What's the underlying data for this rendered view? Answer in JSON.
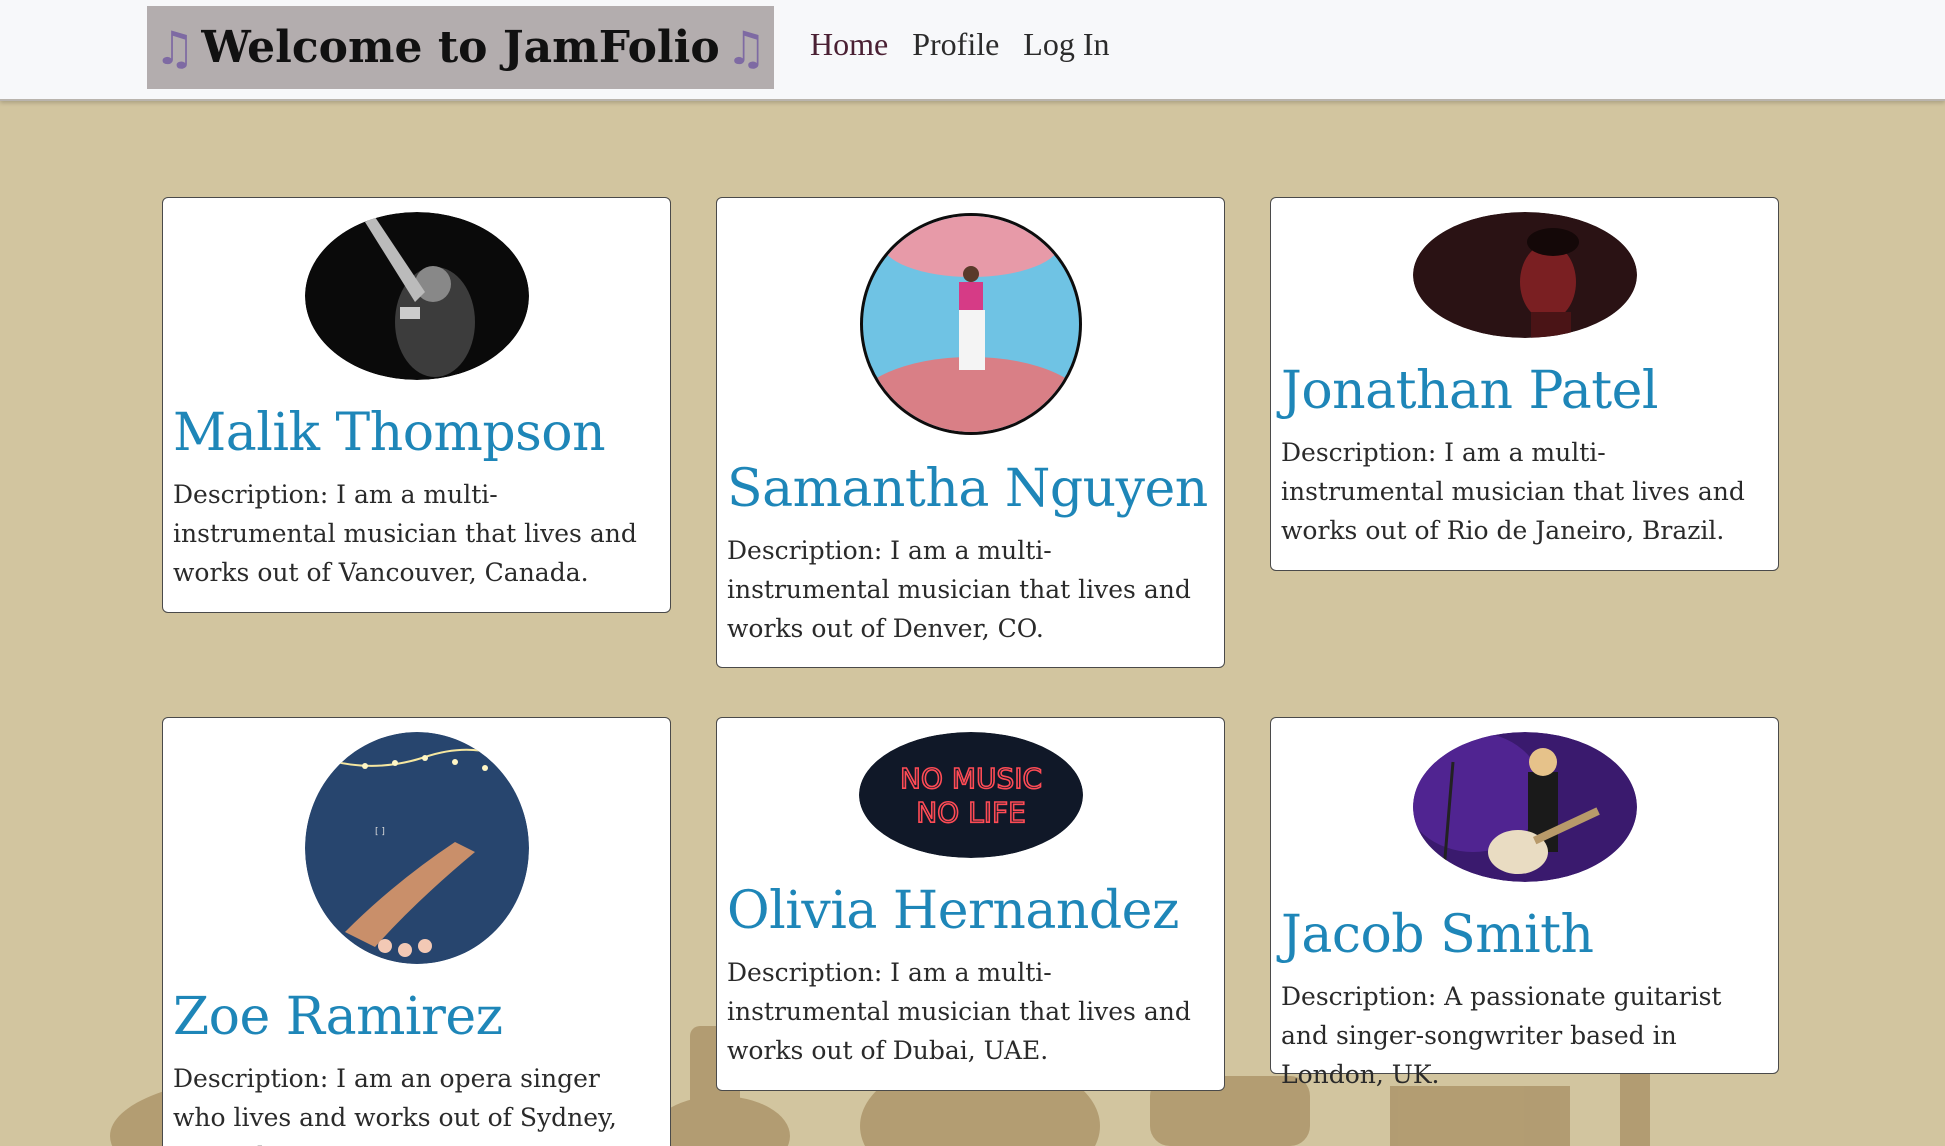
{
  "nav": {
    "brand": "Welcome to JamFolio",
    "brand_icon": "music-note-icon",
    "links": [
      "Home",
      "Profile",
      "Log In"
    ]
  },
  "colors": {
    "page_bg": "#d2c59f",
    "navbar_bg": "#f7f8fa",
    "brand_bg": "#b3adae",
    "name_color": "#1e86b8",
    "note_color": "#7e6aa3"
  },
  "musicians": [
    {
      "name": "Malik Thompson",
      "description": "Description: I am a multi-instrumental musician that lives and works out of Vancouver, Canada.",
      "image": "concert-performer-photo"
    },
    {
      "name": "Samantha Nguyen",
      "description": "Description: I am a multi-instrumental musician that lives and works out of Denver, CO.",
      "image": "fisheye-stage-photo"
    },
    {
      "name": "Jonathan Patel",
      "description": "Description: I am a multi-instrumental musician that lives and works out of Rio de Janeiro, Brazil.",
      "image": "red-lit-portrait-photo"
    },
    {
      "name": "Zoe Ramirez",
      "description": "Description: I am an opera singer who lives and works out of Sydney, Australia.",
      "image": "starry-night-hand-photo"
    },
    {
      "name": "Olivia Hernandez",
      "description": "Description: I am a multi-instrumental musician that lives and works out of Dubai, UAE.",
      "image": "neon-sign-photo",
      "image_text": "NO MUSIC NO LIFE"
    },
    {
      "name": "Jacob Smith",
      "description": "Description: A passionate guitarist and singer-songwriter based in London, UK.",
      "image": "guitarist-stage-photo"
    }
  ]
}
